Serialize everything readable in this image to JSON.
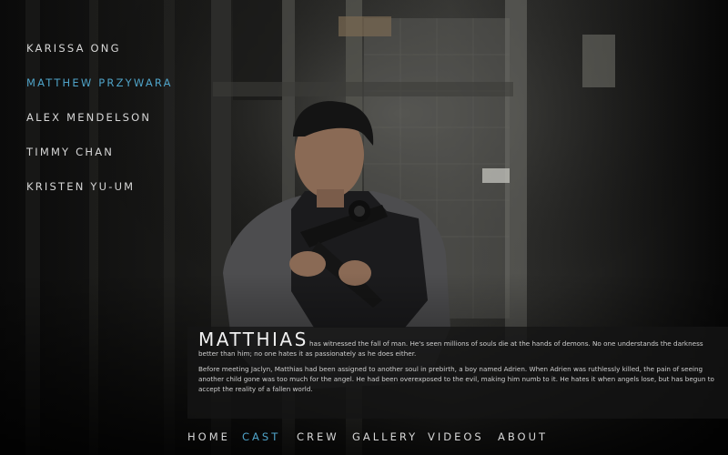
{
  "cast": {
    "items": [
      {
        "label": "KARISSA ONG",
        "active": false
      },
      {
        "label": "MATTHEW PRZYWARA",
        "active": true
      },
      {
        "label": "ALEX MENDELSON",
        "active": false
      },
      {
        "label": "TIMMY CHAN",
        "active": false
      },
      {
        "label": "KRISTEN YU-UM",
        "active": false
      }
    ]
  },
  "bio": {
    "name": "MATTHIAS",
    "paragraph1": "has witnessed the fall of man. He's seen millions of souls die at the hands of demons. No one understands the darkness better than him; no one hates it as passionately as he does either.",
    "paragraph2": "Before meeting Jaclyn, Matthias had been assigned to another soul in prebirth, a boy named Adrien. When Adrien was ruthlessly killed, the pain of seeing another child gone was too much for the angel. He had been overexposed to the evil, making him numb to it. He hates it when angels lose, but has begun to accept the reality of a fallen world."
  },
  "nav": {
    "home": "HOME",
    "cast": "CAST",
    "crew": "CREW",
    "gallery": "GALLERY",
    "videos": "VIDEOS",
    "about": "ABOUT"
  },
  "colors": {
    "accent": "#4fa3c8",
    "text": "#d6d6d6",
    "panel": "#141414"
  }
}
